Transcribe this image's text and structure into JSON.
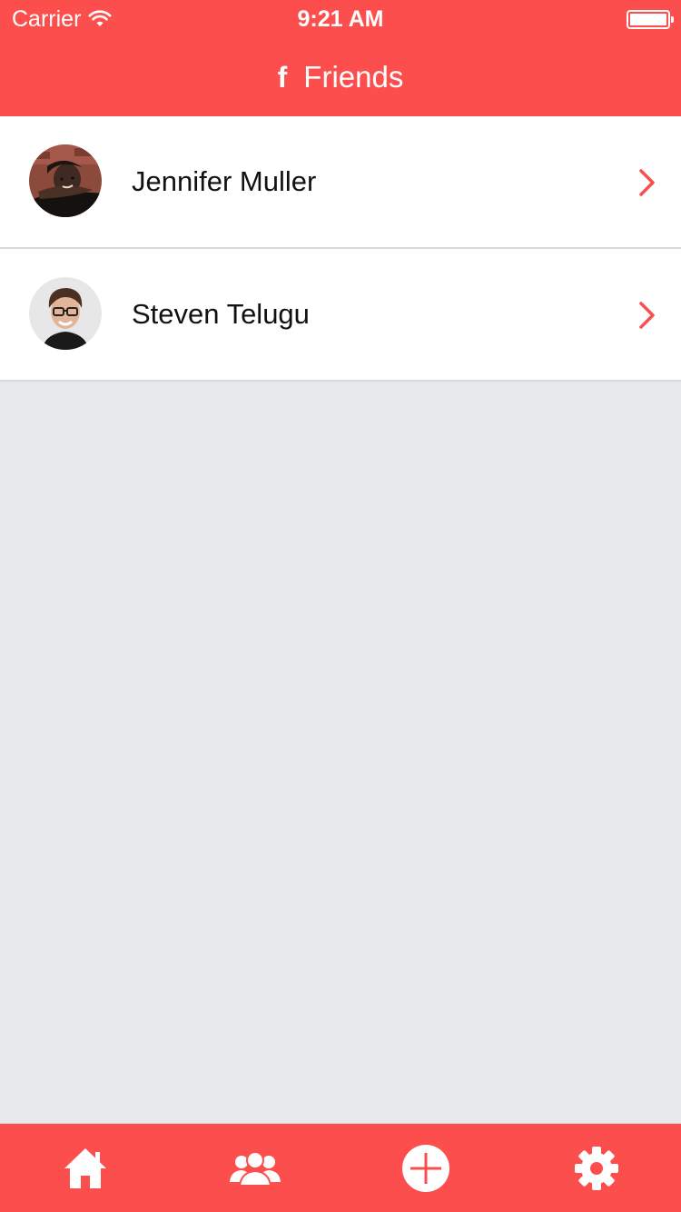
{
  "status_bar": {
    "carrier": "Carrier",
    "time": "9:21 AM"
  },
  "nav": {
    "icon": "facebook-icon",
    "icon_glyph": "f",
    "title": "Friends"
  },
  "friends": [
    {
      "name": "Jennifer Muller",
      "avatar": "avatar-photo-jennifer"
    },
    {
      "name": "Steven Telugu",
      "avatar": "avatar-photo-steven"
    }
  ],
  "tabbar": {
    "tabs": [
      {
        "icon": "home-icon"
      },
      {
        "icon": "friends-icon"
      },
      {
        "icon": "add-circle-icon"
      },
      {
        "icon": "gear-icon"
      }
    ]
  },
  "colors": {
    "accent": "#fd4e4e",
    "background": "#e8e9ed",
    "row_background": "#ffffff",
    "separator": "#d8d9dc"
  }
}
